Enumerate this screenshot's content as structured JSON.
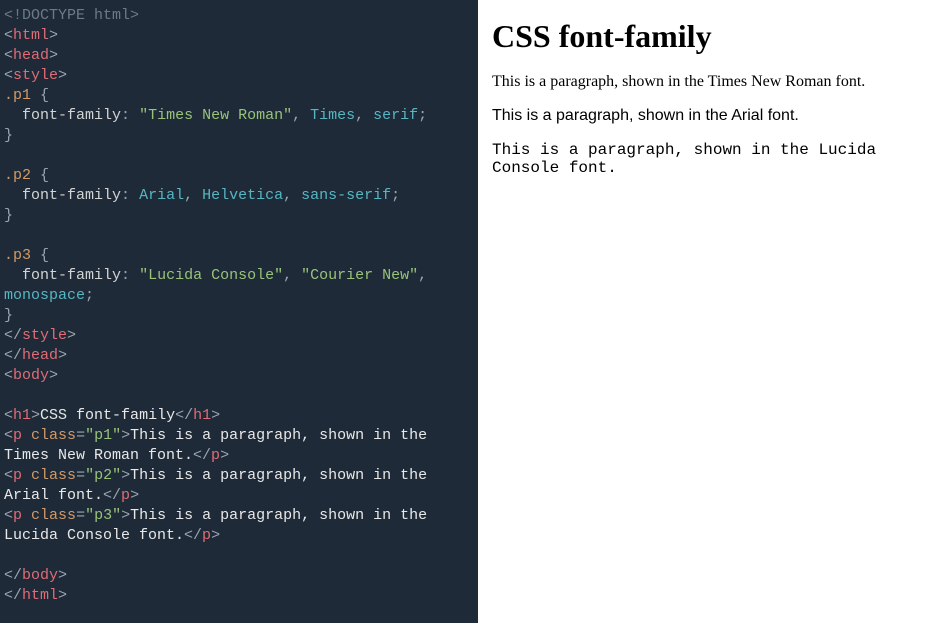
{
  "code": {
    "doctype": "<!DOCTYPE html>",
    "html_open": "html",
    "head_open": "head",
    "style_open": "style",
    "sel_p1": ".p1",
    "brace_open": "{",
    "prop_ff": "font-family",
    "colon_sp": ": ",
    "val_p1_q1": "\"Times New Roman\"",
    "comma": ", ",
    "val_p1_2": "Times",
    "val_p1_3": "serif",
    "semi": ";",
    "brace_close": "}",
    "sel_p2": ".p2",
    "val_p2_1": "Arial",
    "val_p2_2": "Helvetica",
    "val_p2_3": "sans-serif",
    "sel_p3": ".p3",
    "val_p3_q1": "\"Lucida Console\"",
    "val_p3_q2": "\"Courier New\"",
    "val_p3_3": "monospace",
    "style_close": "style",
    "head_close": "head",
    "body_open": "body",
    "h1_open": "h1",
    "h1_text": "CSS font-family",
    "h1_close": "h1",
    "p_open": "p",
    "attr_class": "class",
    "eq": "=",
    "class_p1": "\"p1\"",
    "p1_text_a": "This is a paragraph, shown in the ",
    "p1_text_b": "Times New Roman font.",
    "class_p2": "\"p2\"",
    "p2_text_a": "This is a paragraph, shown in the ",
    "p2_text_b": "Arial font.",
    "class_p3": "\"p3\"",
    "p3_text_a": "This is a paragraph, shown in the ",
    "p3_text_b": "Lucida Console font.",
    "p_close": "p",
    "body_close": "body",
    "html_close": "html",
    "lt": "<",
    "gt": ">",
    "lts": "</"
  },
  "preview": {
    "heading": "CSS font-family",
    "para1": "This is a paragraph, shown in the Times New Roman font.",
    "para2": "This is a paragraph, shown in the Arial font.",
    "para3": "This is a paragraph, shown in the Lucida Console font."
  }
}
